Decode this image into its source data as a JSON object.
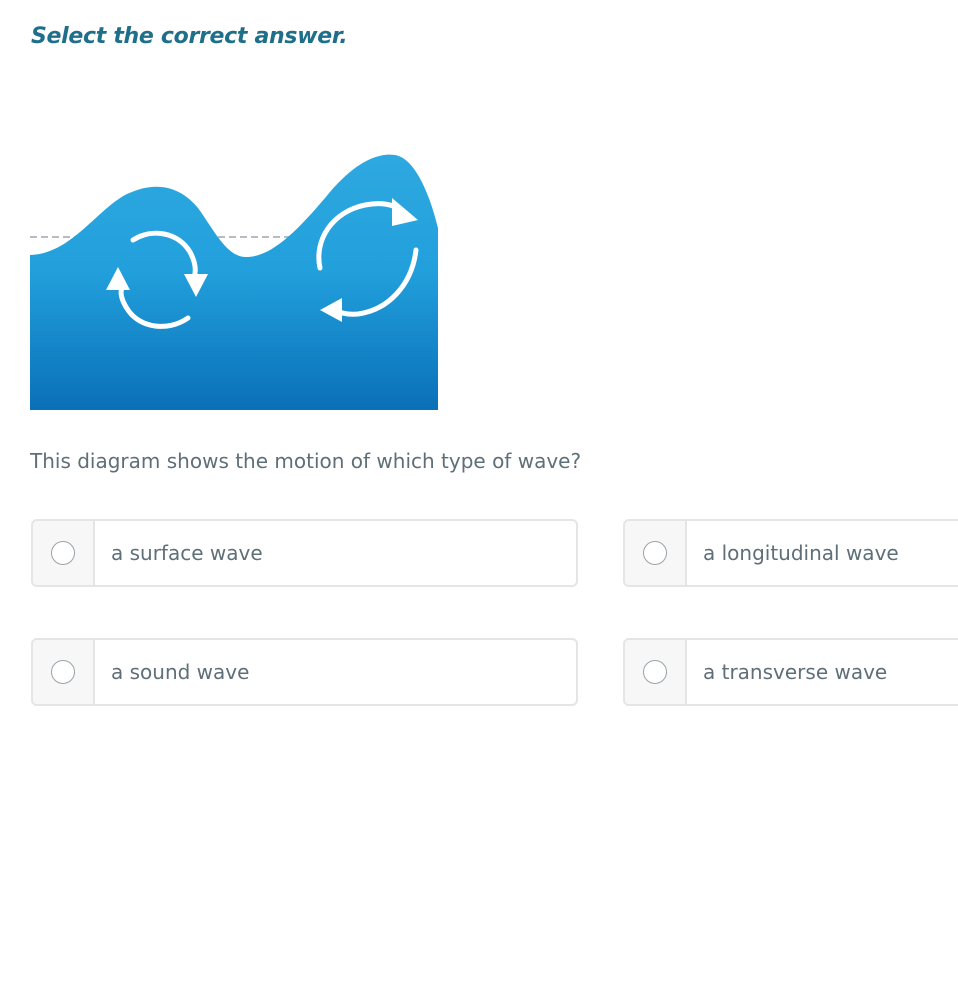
{
  "instruction": "Select the correct answer.",
  "question": "This diagram shows the motion of which type of wave?",
  "options": [
    {
      "label": "a surface wave"
    },
    {
      "label": "a longitudinal wave"
    },
    {
      "label": "a sound wave"
    },
    {
      "label": "a transverse wave"
    }
  ],
  "colors": {
    "instruction": "#1f6f8b",
    "water_top": "#2ea8e0",
    "water_bottom": "#0a72b9",
    "text": "#5f6f78",
    "border": "#e3e5e7"
  },
  "icons": [
    "circular-arrows-icon",
    "circular-arrows-icon",
    "radio-icon"
  ]
}
